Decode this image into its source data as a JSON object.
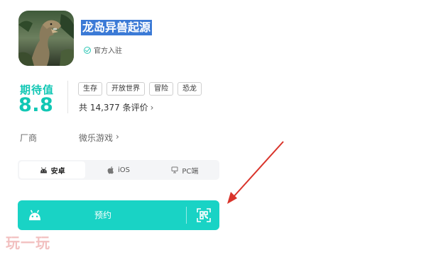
{
  "game": {
    "title": "龙岛异兽起源",
    "official_badge": "官方入驻"
  },
  "rating": {
    "label": "期待值",
    "value": "8.8",
    "tags": [
      "生存",
      "开放世界",
      "冒险",
      "恐龙"
    ],
    "reviews": "共 14,377 条评价"
  },
  "developer": {
    "label": "厂商",
    "name": "微乐游戏"
  },
  "platforms": [
    {
      "label": "安卓",
      "icon": "android-icon",
      "active": true
    },
    {
      "label": "iOS",
      "icon": "apple-icon",
      "active": false
    },
    {
      "label": "PC端",
      "icon": "monitor-icon",
      "active": false
    }
  ],
  "reserve": {
    "label": "预约",
    "icon": "android-icon",
    "qr_icon": "qr-scan-icon"
  },
  "watermark": "玩一玩",
  "colors": {
    "accent": "#11c7b4",
    "button": "#19d3c5",
    "title_highlight": "#3b7ad6",
    "arrow": "#d9342b"
  }
}
